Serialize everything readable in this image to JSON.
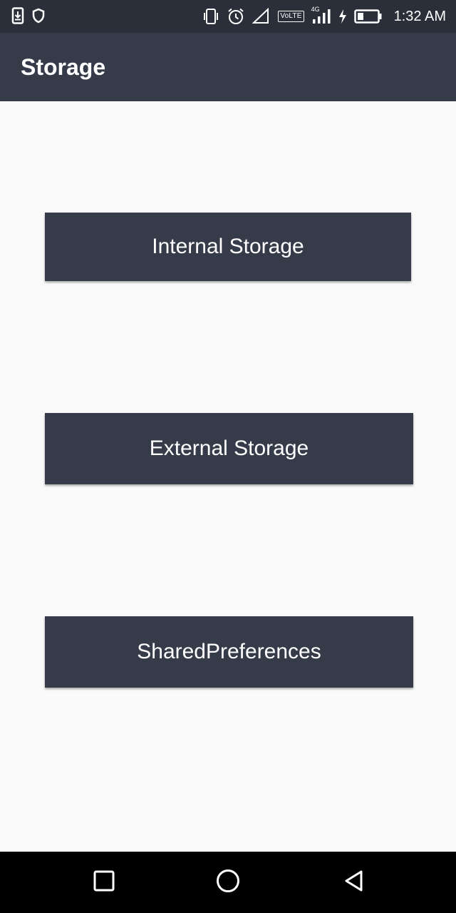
{
  "status_bar": {
    "time": "1:32 AM",
    "volte_label": "VoLTE",
    "network_label": "4G",
    "icons": [
      "download-notification-icon",
      "shield-icon",
      "vibrate-icon",
      "alarm-icon",
      "signal-empty-icon",
      "volte-icon",
      "signal-4g-icon",
      "charging-icon",
      "battery-icon"
    ]
  },
  "app_bar": {
    "title": "Storage"
  },
  "buttons": {
    "internal": "Internal Storage",
    "external": "External Storage",
    "shared": "SharedPreferences"
  },
  "nav_bar": {
    "icons": [
      "recents-icon",
      "home-icon",
      "back-icon"
    ]
  },
  "colors": {
    "primary": "#363b4a",
    "status_bar": "#2b2f3a",
    "background": "#fafafa",
    "nav_bar": "#000000"
  }
}
